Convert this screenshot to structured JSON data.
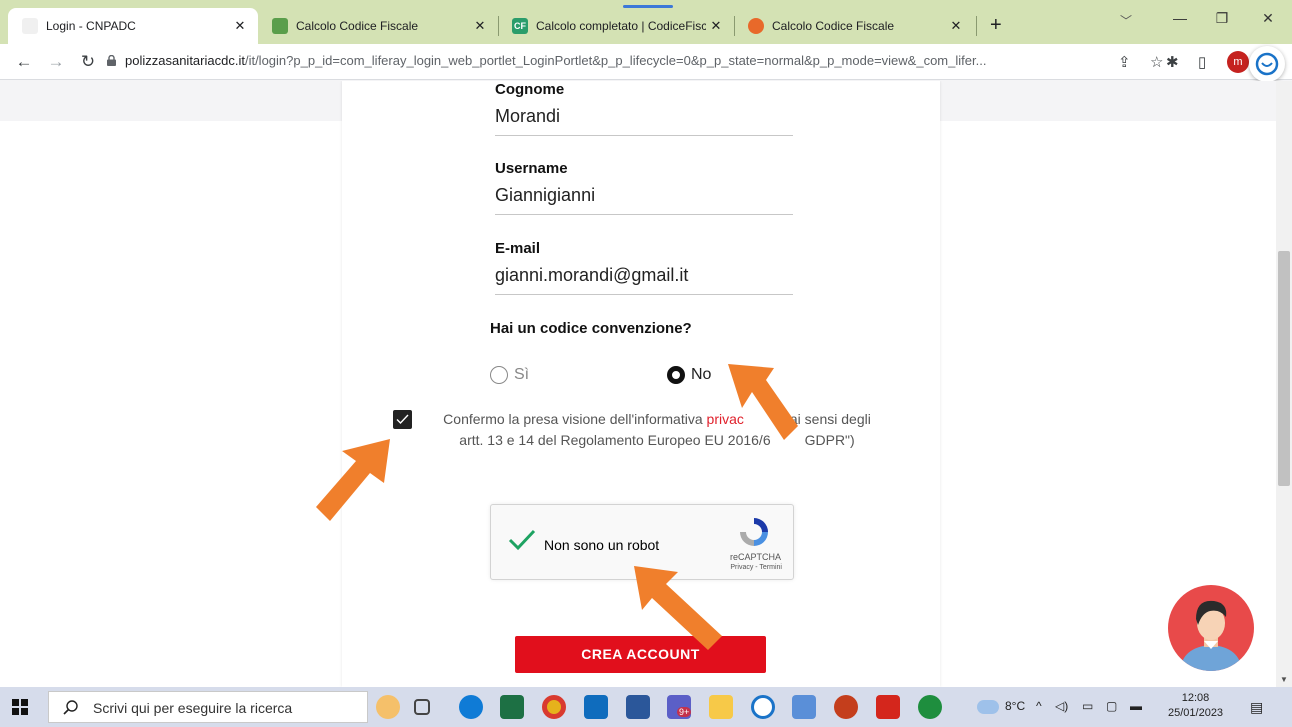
{
  "browser": {
    "tabs": [
      {
        "title": "Login - CNPADC",
        "active": true
      },
      {
        "title": "Calcolo Codice Fiscale",
        "active": false
      },
      {
        "title": "Calcolo completato | CodiceFisca",
        "active": false
      },
      {
        "title": "Calcolo Codice Fiscale",
        "active": false
      }
    ],
    "url_domain": "polizzasanitariacdc.it",
    "url_path": "/it/login?p_p_id=com_liferay_login_web_portlet_LoginPortlet&p_p_lifecycle=0&p_p_state=normal&p_p_mode=view&_com_lifer...",
    "profile_initial": "m",
    "tab_icon_glyph": "CF"
  },
  "form": {
    "surname_label": "Cognome",
    "surname_value": "Morandi",
    "username_label": "Username",
    "username_value": "Giannigianni",
    "email_label": "E-mail",
    "email_value": "gianni.morandi@gmail.it",
    "convention_question": "Hai un codice convenzione?",
    "option_yes": "Sì",
    "option_no": "No",
    "selected_option": "No",
    "consent_checked": true,
    "consent_part1": "Confermo la presa visione dell'informativa ",
    "consent_link": "privac",
    "consent_part2": "ai sensi degli",
    "consent_line2a": "artt. 13 e 14 del Regolamento Europeo EU 2016/6",
    "consent_line2b": "GDPR\")",
    "captcha_label": "Non sono un robot",
    "captcha_brand": "reCAPTCHA",
    "captcha_terms": "Privacy - Termini",
    "create_button": "CREA ACCOUNT"
  },
  "taskbar": {
    "search_placeholder": "Scrivi qui per eseguire la ricerca",
    "weather": "8°C",
    "time": "12:08",
    "date": "25/01/2023",
    "teams_badge": "9+"
  },
  "colors": {
    "accent_red": "#e10f1c",
    "arrow_orange": "#f07f2c",
    "tab_strip": "#d4e2b4"
  },
  "icons": [
    "lock-icon",
    "star-icon",
    "share-icon",
    "extensions-icon",
    "sidepanel-icon",
    "recaptcha-icon",
    "checkmark-icon",
    "windows-start-icon",
    "search-icon"
  ]
}
